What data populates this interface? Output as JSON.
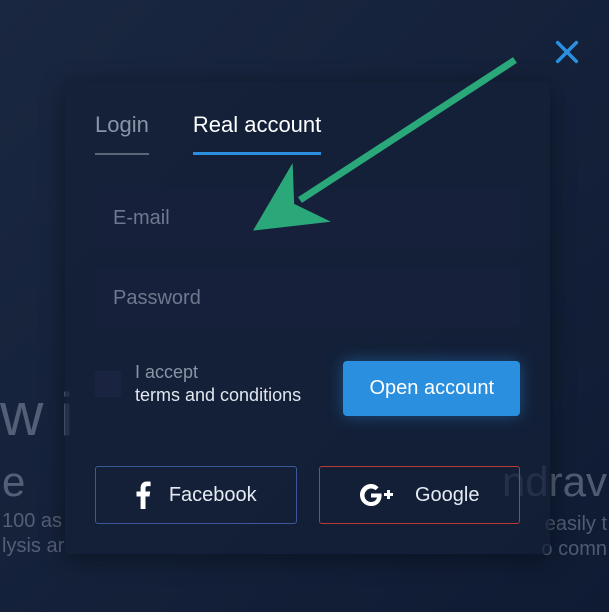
{
  "background": {
    "frag1": "w i",
    "frag2": "e",
    "frag3": "100 as",
    "frag4": "lysis ar",
    "frag5": "ndrav",
    "frag6": "easily t",
    "frag7": "o comn"
  },
  "close": {
    "name": "close"
  },
  "tabs": {
    "login": "Login",
    "real": "Real account"
  },
  "form": {
    "email_placeholder": "E-mail",
    "password_placeholder": "Password",
    "accept_prefix": "I accept",
    "accept_tc": "terms and conditions",
    "open_label": "Open account"
  },
  "social": {
    "facebook": "Facebook",
    "google": "Google"
  }
}
